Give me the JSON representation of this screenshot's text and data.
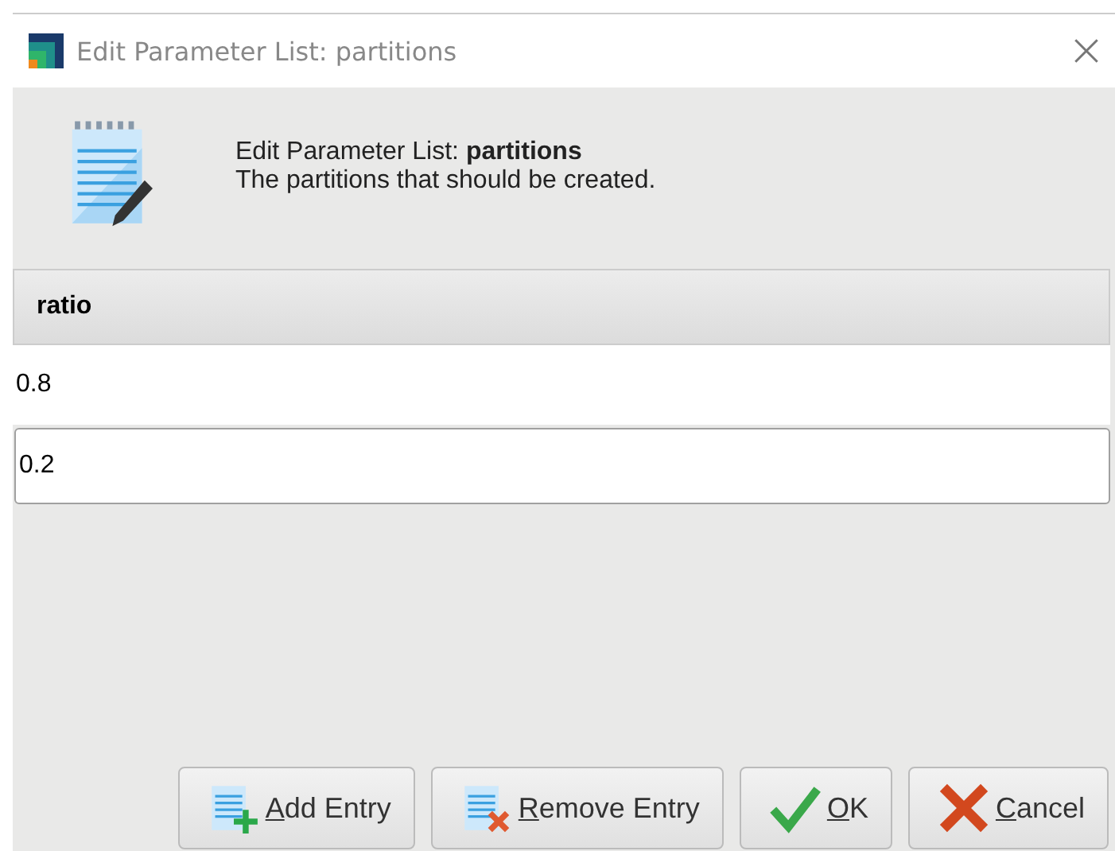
{
  "window": {
    "title": "Edit Parameter List: partitions"
  },
  "header": {
    "title": "Edit Parameter List: **partitions**",
    "description": "The partitions that should be created."
  },
  "table": {
    "columns": [
      "ratio"
    ],
    "rows": [
      {
        "cells": [
          "0.8"
        ],
        "selected": false
      },
      {
        "cells": [
          "0.2"
        ],
        "selected": true
      }
    ]
  },
  "buttons": [
    {
      "kind": "add",
      "mnemonic": "A",
      "rest": "dd Entry"
    },
    {
      "kind": "remove",
      "mnemonic": "R",
      "rest": "emove Entry"
    },
    {
      "kind": "ok",
      "mnemonic": "O",
      "rest": "K"
    },
    {
      "kind": "cancel",
      "mnemonic": "C",
      "rest": "ancel"
    }
  ]
}
